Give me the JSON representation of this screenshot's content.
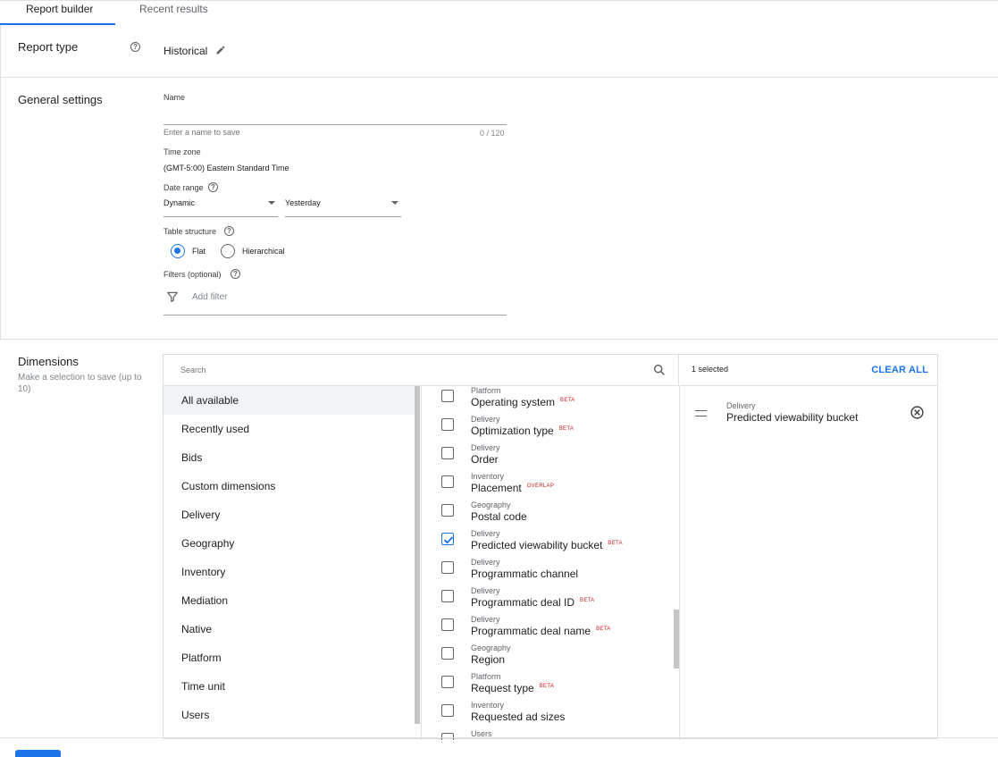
{
  "tabs": [
    {
      "label": "Report builder",
      "active": true
    },
    {
      "label": "Recent results",
      "active": false
    }
  ],
  "report_type": {
    "label": "Report type",
    "value": "Historical"
  },
  "general_settings": {
    "title": "General settings",
    "name_label": "Name",
    "name_placeholder": "Enter a name to save",
    "name_counter": "0 / 120",
    "timezone_label": "Time zone",
    "timezone_value": "(GMT-5:00) Eastern Standard Time",
    "date_range_label": "Date range",
    "date_range_type": "Dynamic",
    "date_range_value": "Yesterday",
    "table_structure_label": "Table structure",
    "table_structure_options": [
      "Flat",
      "Hierarchical"
    ],
    "table_structure_selected": "Flat",
    "filters_label": "Filters (optional)",
    "add_filter_label": "Add filter"
  },
  "dimensions": {
    "title": "Dimensions",
    "subtitle": "Make a selection to save (up to 10)",
    "search_placeholder": "Search",
    "categories": [
      "All available",
      "Recently used",
      "Bids",
      "Custom dimensions",
      "Delivery",
      "Geography",
      "Inventory",
      "Mediation",
      "Native",
      "Platform",
      "Time unit",
      "Users"
    ],
    "active_category": "All available",
    "items": [
      {
        "category": "Platform",
        "name": "Operating system",
        "badge": "BETA",
        "checked": false
      },
      {
        "category": "Delivery",
        "name": "Optimization type",
        "badge": "BETA",
        "checked": false
      },
      {
        "category": "Delivery",
        "name": "Order",
        "badge": "",
        "checked": false
      },
      {
        "category": "Inventory",
        "name": "Placement",
        "badge": "OVERLAP",
        "checked": false
      },
      {
        "category": "Geography",
        "name": "Postal code",
        "badge": "",
        "checked": false
      },
      {
        "category": "Delivery",
        "name": "Predicted viewability bucket",
        "badge": "BETA",
        "checked": true
      },
      {
        "category": "Delivery",
        "name": "Programmatic channel",
        "badge": "",
        "checked": false
      },
      {
        "category": "Delivery",
        "name": "Programmatic deal ID",
        "badge": "BETA",
        "checked": false
      },
      {
        "category": "Delivery",
        "name": "Programmatic deal name",
        "badge": "BETA",
        "checked": false
      },
      {
        "category": "Geography",
        "name": "Region",
        "badge": "",
        "checked": false
      },
      {
        "category": "Platform",
        "name": "Request type",
        "badge": "BETA",
        "checked": false
      },
      {
        "category": "Inventory",
        "name": "Requested ad sizes",
        "badge": "",
        "checked": false
      },
      {
        "category": "Users",
        "name": "",
        "badge": "",
        "checked": false
      }
    ],
    "selected_count": "1 selected",
    "clear_all": "CLEAR ALL",
    "selected": [
      {
        "category": "Delivery",
        "name": "Predicted viewability bucket"
      }
    ]
  },
  "colors": {
    "accent": "#1a73e8",
    "badge": "#c5221f"
  }
}
